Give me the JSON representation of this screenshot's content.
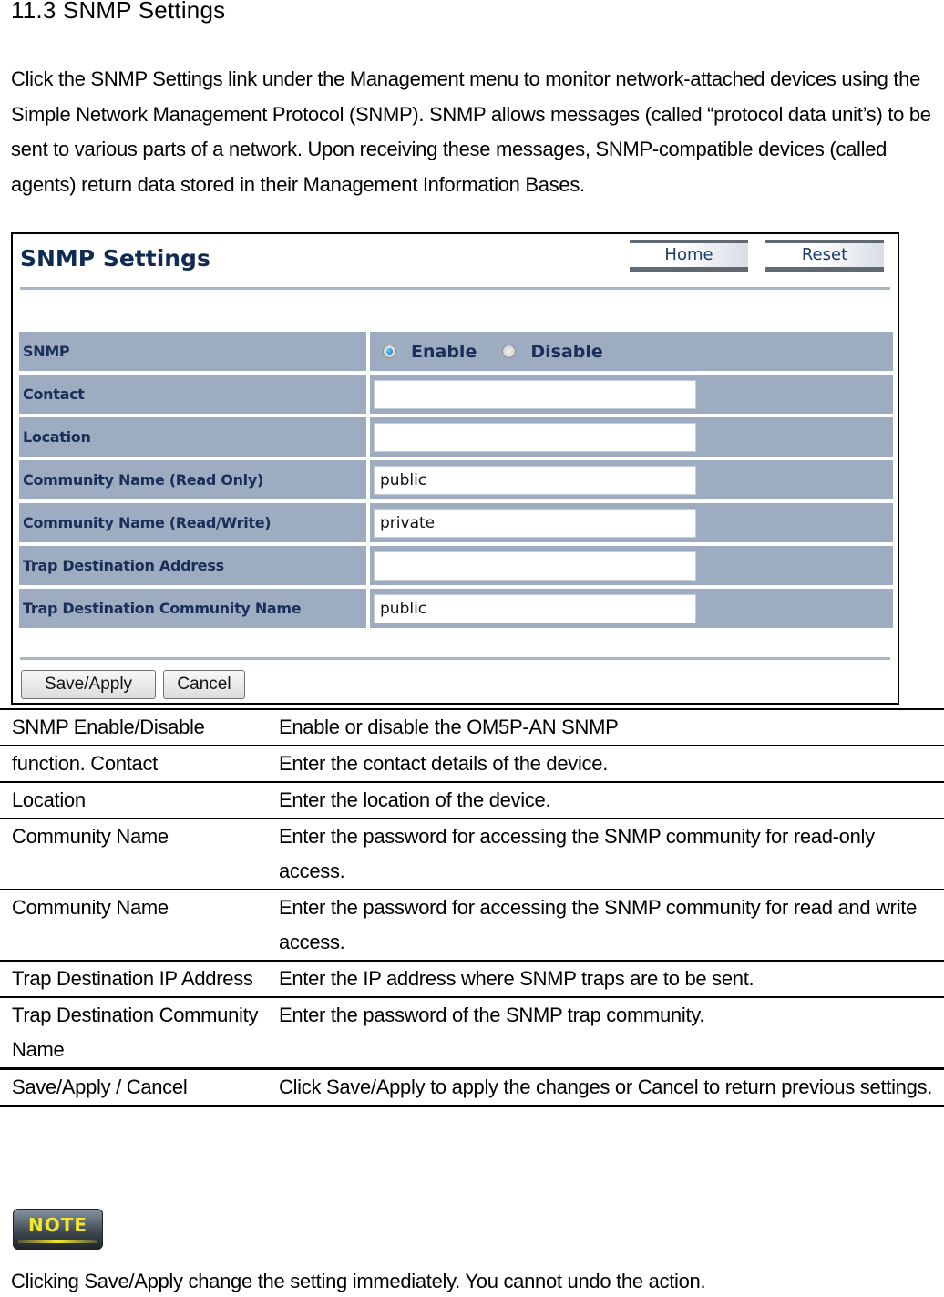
{
  "section_heading": "11.3 SNMP Settings",
  "intro_paragraph": "Click the SNMP Settings link under the Management menu to monitor network-attached devices using the Simple Network Management Protocol (SNMP). SNMP allows messages (called “protocol data unit’s) to be sent to various parts of a network. Upon receiving these messages, SNMP-compatible devices (called agents) return data stored in their Management Information Bases.",
  "screenshot": {
    "title": "SNMP Settings",
    "header_buttons": {
      "home": "Home",
      "reset": "Reset"
    },
    "snmp_row": {
      "label": "SNMP",
      "options": [
        {
          "label": "Enable",
          "selected": true
        },
        {
          "label": "Disable",
          "selected": false
        }
      ]
    },
    "fields": [
      {
        "label": "Contact",
        "value": ""
      },
      {
        "label": "Location",
        "value": ""
      },
      {
        "label": "Community Name (Read Only)",
        "value": "public"
      },
      {
        "label": "Community Name (Read/Write)",
        "value": "private"
      },
      {
        "label": "Trap Destination Address",
        "value": ""
      },
      {
        "label": "Trap Destination Community Name",
        "value": "public"
      }
    ],
    "footer_buttons": {
      "save_apply": "Save/Apply",
      "cancel": "Cancel"
    }
  },
  "description_table": [
    {
      "term": "SNMP Enable/Disable",
      "description": "Enable or disable the OM5P-AN SNMP"
    },
    {
      "term": "function. Contact",
      "description": "Enter the contact details of the device."
    },
    {
      "term": "Location",
      "description": "Enter the location of the device."
    },
    {
      "term": "Community Name",
      "description": "Enter the password for accessing the SNMP community for read-only access."
    },
    {
      "term": "Community Name",
      "description": "Enter the password for accessing the SNMP community for read and write access."
    },
    {
      "term": "Trap Destination IP Address",
      "description": "Enter the IP address where SNMP traps are to be sent."
    },
    {
      "term": "Trap Destination Community Name",
      "description": "Enter the password of the SNMP trap community."
    },
    {
      "term": "Save/Apply / Cancel",
      "description": "Click Save/Apply to apply the changes or Cancel to return previous settings."
    }
  ],
  "note": {
    "badge": "NOTE",
    "text": "Clicking Save/Apply change the setting immediately. You cannot undo the action."
  }
}
